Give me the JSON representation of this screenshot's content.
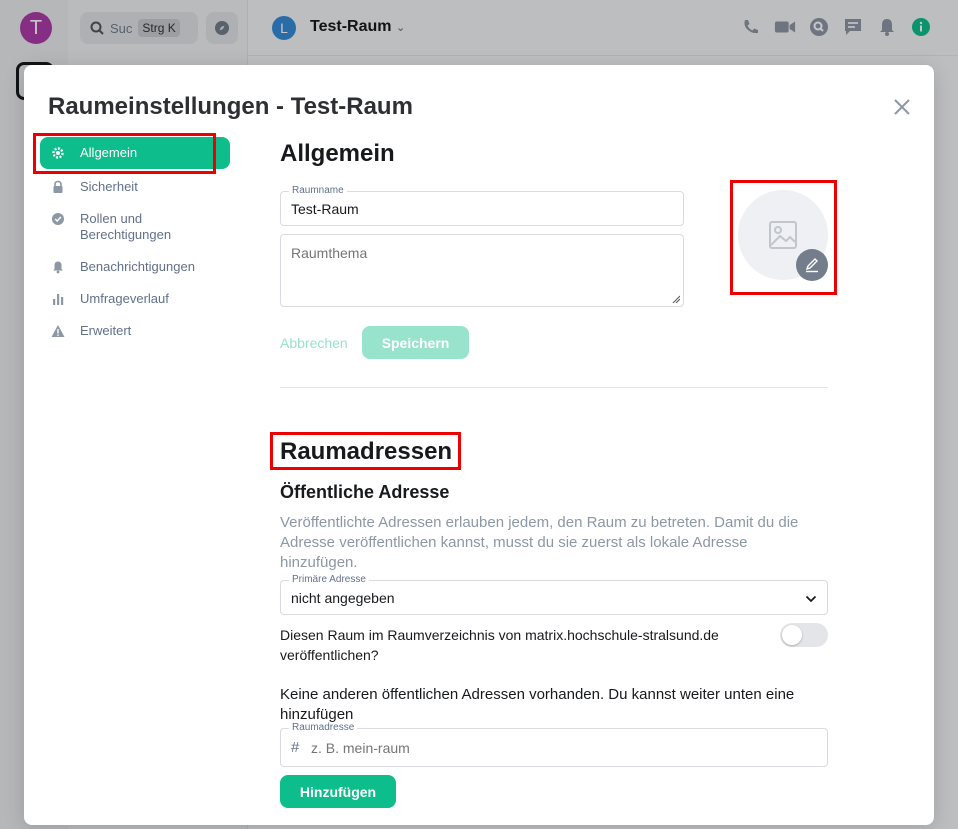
{
  "background": {
    "user_avatar_letter": "T",
    "search_placeholder": "Suc",
    "search_shortcut": "Strg K",
    "room_avatar_letter": "L",
    "room_name": "Test-Raum"
  },
  "dialog": {
    "title": "Raumeinstellungen - Test-Raum",
    "close_label": "×"
  },
  "tabs": [
    {
      "label": "Allgemein",
      "icon": "gear-icon",
      "active": true
    },
    {
      "label": "Sicherheit",
      "icon": "lock-icon"
    },
    {
      "label": "Rollen und Berechtigungen",
      "icon": "shield-check-icon"
    },
    {
      "label": "Benachrichtigungen",
      "icon": "bell-icon"
    },
    {
      "label": "Umfrageverlauf",
      "icon": "bar-chart-icon"
    },
    {
      "label": "Erweitert",
      "icon": "warning-icon"
    }
  ],
  "general": {
    "heading": "Allgemein",
    "room_name_label": "Raumname",
    "room_name_value": "Test-Raum",
    "topic_placeholder": "Raumthema",
    "cancel_label": "Abbrechen",
    "save_label": "Speichern"
  },
  "addresses": {
    "heading": "Raumadressen",
    "public_heading": "Öffentliche Adresse",
    "public_desc": "Veröffentlichte Adressen erlauben jedem, den Raum zu betreten. Damit du die Adresse veröffentlichen kannst, musst du sie zuerst als lokale Adresse hinzufügen.",
    "primary_label": "Primäre Adresse",
    "primary_value": "nicht angegeben",
    "publish_text": "Diesen Raum im Raumverzeichnis von matrix.hochschule-stralsund.de veröffentlichen?",
    "publish_enabled": false,
    "none_text": "Keine anderen öffentlichen Adressen vorhanden. Du kannst weiter unten eine hinzufügen",
    "room_address_label": "Raumadresse",
    "room_address_prefix": "#",
    "room_address_placeholder": "z. B. mein-raum",
    "add_label": "Hinzufügen"
  },
  "colors": {
    "accent": "#0dbd8b",
    "accent_disabled": "#98e3cb",
    "highlight": "#e00000"
  }
}
